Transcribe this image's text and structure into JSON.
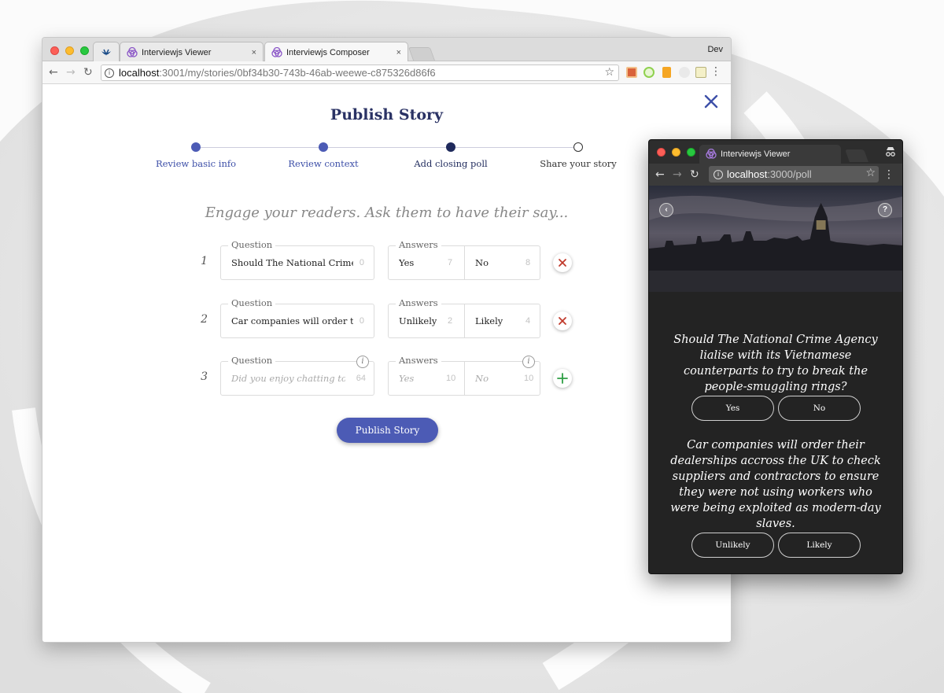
{
  "main_window": {
    "tabs": [
      {
        "label": ""
      },
      {
        "label": "Interviewjs Viewer"
      },
      {
        "label": "Interviewjs Composer"
      }
    ],
    "profile": "Dev",
    "address": {
      "host": "localhost",
      "path": ":3001/my/stories/0bf34b30-743b-46ab-weewe-c875326d86f6"
    },
    "page": {
      "title": "Publish Story",
      "steps": [
        {
          "label": "Review basic info",
          "state": "done"
        },
        {
          "label": "Review context",
          "state": "done"
        },
        {
          "label": "Add closing poll",
          "state": "current"
        },
        {
          "label": "Share your story",
          "state": "todo"
        }
      ],
      "tagline": "Engage your readers. Ask them to have their say...",
      "question_label": "Question",
      "answers_label": "Answers",
      "polls": [
        {
          "num": "1",
          "question": "Should The National Crime Agency lialise with its Vietnamese counterparts to try to break the people-smuggling rings?",
          "question_count": "0",
          "answer1": "Yes",
          "answer1_count": "7",
          "answer2": "No",
          "answer2_count": "8",
          "action": "remove"
        },
        {
          "num": "2",
          "question": "Car companies will order their dealerships accross the UK to check suppliers and contractors to ensure they were not using workers who were being exploited as modern-day slaves.",
          "question_count": "0",
          "answer1": "Unlikely",
          "answer1_count": "2",
          "answer2": "Likely",
          "answer2_count": "4",
          "action": "remove"
        },
        {
          "num": "3",
          "question_placeholder": "Did you enjoy chatting to...?",
          "question_count": "64",
          "answer1_placeholder": "Yes",
          "answer1_count": "10",
          "answer2_placeholder": "No",
          "answer2_count": "10",
          "action": "add"
        }
      ],
      "publish_button": "Publish Story"
    }
  },
  "viewer_window": {
    "tab": "Interviewjs Viewer",
    "address": {
      "host": "localhost",
      "path": ":3000/poll"
    },
    "back_glyph": "‹",
    "help_glyph": "?",
    "questions": [
      {
        "text": "Should The National Crime Agency lialise with its Vietnamese counterparts to try to break the people-smuggling rings?",
        "answers": [
          "Yes",
          "No"
        ]
      },
      {
        "text": "Car companies will order their dealerships accross the UK to check suppliers and contractors to ensure they were not using workers who were being exploited as modern-day slaves.",
        "answers": [
          "Unlikely",
          "Likely"
        ]
      }
    ]
  },
  "colors": {
    "accent": "#4c5bb5",
    "navy": "#2a3264",
    "remove": "#c0392b",
    "add": "#2e9e44"
  }
}
